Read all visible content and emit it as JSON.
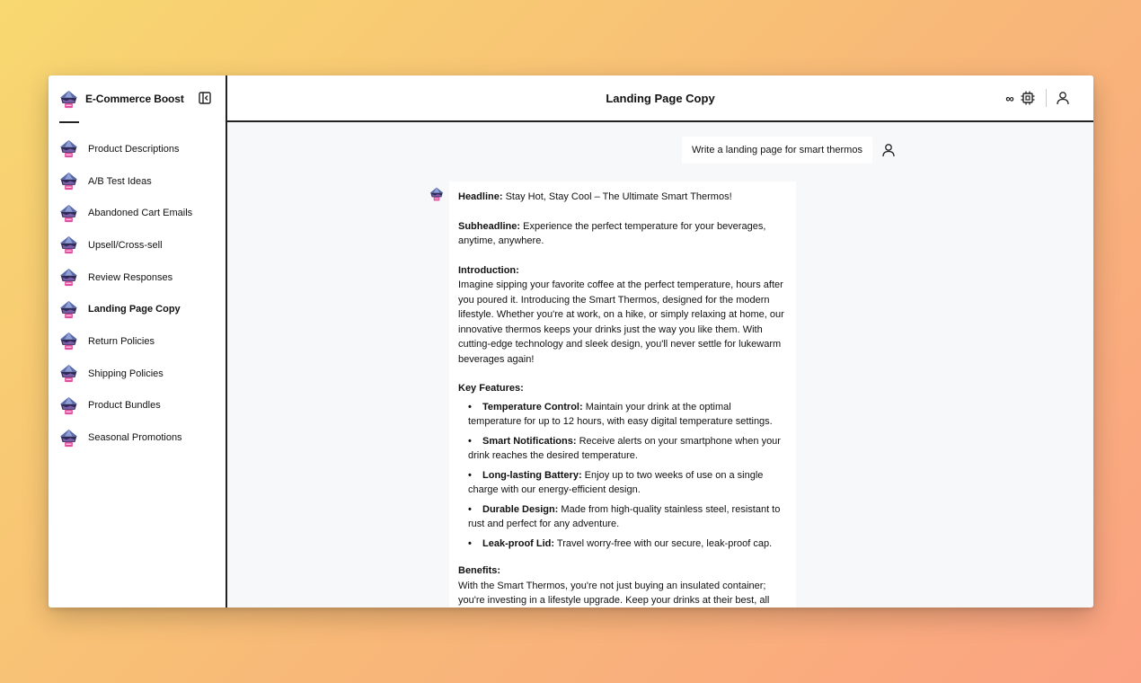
{
  "sidebar": {
    "brand": "E-Commerce Boost",
    "items": [
      {
        "label": "Product Descriptions",
        "active": false
      },
      {
        "label": "A/B Test Ideas",
        "active": false
      },
      {
        "label": "Abandoned Cart Emails",
        "active": false
      },
      {
        "label": "Upsell/Cross-sell",
        "active": false
      },
      {
        "label": "Review Responses",
        "active": false
      },
      {
        "label": "Landing Page Copy",
        "active": true
      },
      {
        "label": "Return Policies",
        "active": false
      },
      {
        "label": "Shipping Policies",
        "active": false
      },
      {
        "label": "Product Bundles",
        "active": false
      },
      {
        "label": "Seasonal Promotions",
        "active": false
      }
    ]
  },
  "header": {
    "title": "Landing Page Copy",
    "infinity_symbol": "∞"
  },
  "chat": {
    "user_message": "Write a landing page for smart thermos",
    "response": {
      "headline_label": "Headline:",
      "headline": " Stay Hot, Stay Cool – The Ultimate Smart Thermos!",
      "subheadline_label": "Subheadline:",
      "subheadline": " Experience the perfect temperature for your beverages, anytime, anywhere.",
      "intro_label": "Introduction:",
      "intro": "Imagine sipping your favorite coffee at the perfect temperature, hours after you poured it. Introducing the Smart Thermos, designed for the modern lifestyle. Whether you're at work, on a hike, or simply relaxing at home, our innovative thermos keeps your drinks just the way you like them. With cutting-edge technology and sleek design, you'll never settle for lukewarm beverages again!",
      "features_label": "Key Features:",
      "features": [
        {
          "title": "Temperature Control:",
          "text": " Maintain your drink at the optimal temperature for up to 12 hours, with easy digital temperature settings."
        },
        {
          "title": "Smart Notifications:",
          "text": " Receive alerts on your smartphone when your drink reaches the desired temperature."
        },
        {
          "title": "Long-lasting Battery:",
          "text": " Enjoy up to two weeks of use on a single charge with our energy-efficient design."
        },
        {
          "title": "Durable Design:",
          "text": " Made from high-quality stainless steel, resistant to rust and perfect for any adventure."
        },
        {
          "title": "Leak-proof Lid:",
          "text": " Travel worry-free with our secure, leak-proof cap."
        }
      ],
      "benefits_label": "Benefits:",
      "benefits": "With the Smart Thermos, you're not just buying an insulated container; you're investing in a lifestyle upgrade. Keep your drinks at their best, all day long."
    }
  }
}
